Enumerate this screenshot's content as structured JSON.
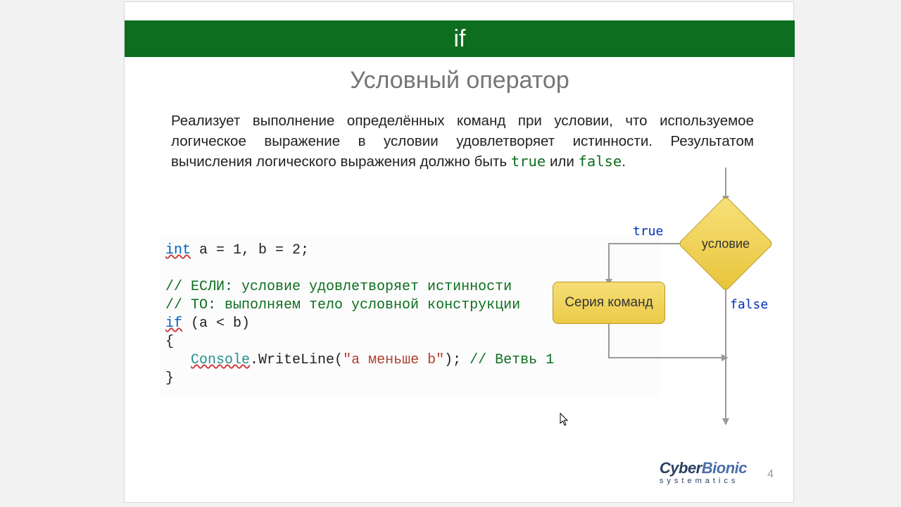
{
  "banner_title": "if",
  "subtitle": "Условный оператор",
  "description_pre": "Реализует выполнение определённых команд при условии, что используемое логическое выражение в условии удовлетворяет истинности. Результатом вычисления логического выражения должно быть ",
  "description_true": "true",
  "description_mid": " или ",
  "description_false": "false",
  "description_post": ".",
  "code": {
    "int": "int",
    "decl_rest": " a = 1, b = 2;",
    "c1": "// ЕСЛИ: условие удовлетворяет истинности",
    "c2": "// ТО: выполняем тело условной конструкции",
    "if": "if",
    "cond": " (a < b)",
    "lbrace": "{",
    "console": "Console",
    "call": ".WriteLine(",
    "strlit": "\"a меньше b\"",
    "after": "); ",
    "c3": "// Ветвь 1",
    "rbrace": "}"
  },
  "flow": {
    "condition": "условие",
    "true": "true",
    "false": "false",
    "box": "Серия команд"
  },
  "logo": {
    "cyber": "Cyber",
    "bionic": "Bionic",
    "sub": "systematics"
  },
  "page": "4"
}
